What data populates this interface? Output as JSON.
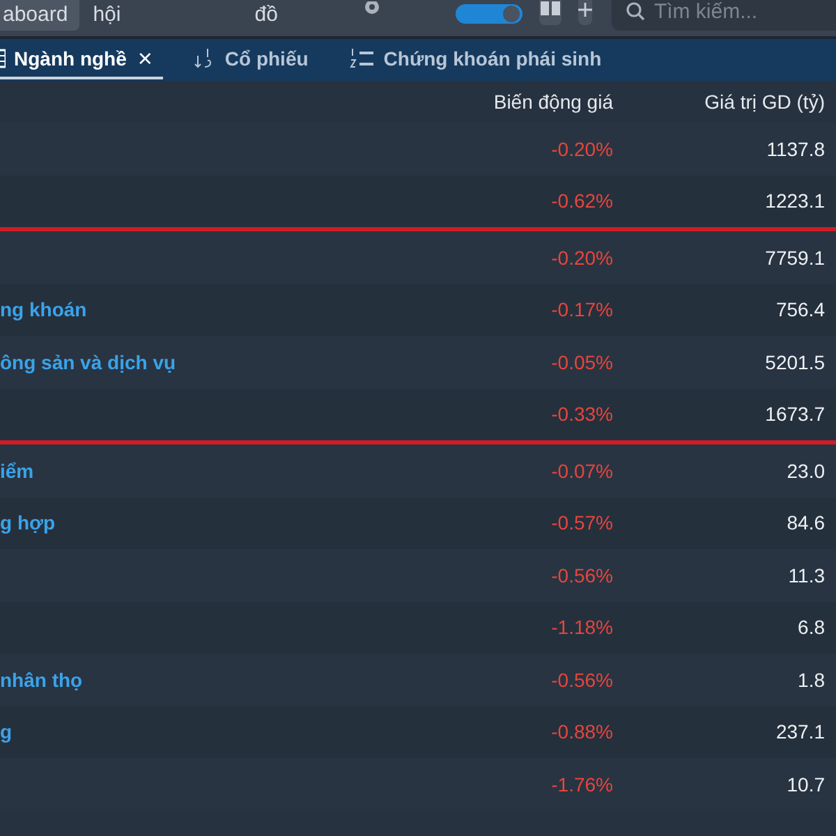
{
  "top_bar": {
    "menu_items": [
      {
        "label": "aboard",
        "selected": true
      },
      {
        "label": "hội",
        "selected": false
      },
      {
        "label": "đồ",
        "selected": false
      }
    ],
    "theme_toggle": {
      "on": true
    },
    "search": {
      "placeholder": "Tìm kiếm..."
    }
  },
  "tabs": [
    {
      "kind": "sector",
      "label": "Ngành nghề",
      "selected": true,
      "close_label": "×"
    },
    {
      "kind": "stock",
      "label": "Cổ phiếu",
      "selected": false
    },
    {
      "kind": "derivative",
      "label": "Chứng khoán phái sinh",
      "selected": false
    }
  ],
  "table": {
    "columns": [
      "Biến động giá",
      "Giá trị GD (tỷ)"
    ],
    "groups": [
      {
        "rows": [
          {
            "name": "",
            "change": "-0.20%",
            "value": "1137.8"
          },
          {
            "name": "",
            "change": "-0.62%",
            "value": "1223.1"
          }
        ]
      },
      {
        "rows": [
          {
            "name": "",
            "change": "-0.20%",
            "value": "7759.1"
          },
          {
            "name": "ng khoán",
            "change": "-0.17%",
            "value": "756.4"
          },
          {
            "name": "ông sản và dịch vụ",
            "change": "-0.05%",
            "value": "5201.5"
          },
          {
            "name": "",
            "change": "-0.33%",
            "value": "1673.7"
          }
        ]
      },
      {
        "rows": [
          {
            "name": "iểm",
            "change": "-0.07%",
            "value": "23.0"
          },
          {
            "name": "g hợp",
            "change": "-0.57%",
            "value": "84.6"
          },
          {
            "name": "",
            "change": "-0.56%",
            "value": "11.3"
          },
          {
            "name": "",
            "change": "-1.18%",
            "value": "6.8"
          },
          {
            "name": "nhân thọ",
            "change": "-0.56%",
            "value": "1.8"
          },
          {
            "name": "g",
            "change": "-0.88%",
            "value": "237.1"
          },
          {
            "name": "",
            "change": "-1.76%",
            "value": "10.7"
          }
        ]
      }
    ]
  }
}
